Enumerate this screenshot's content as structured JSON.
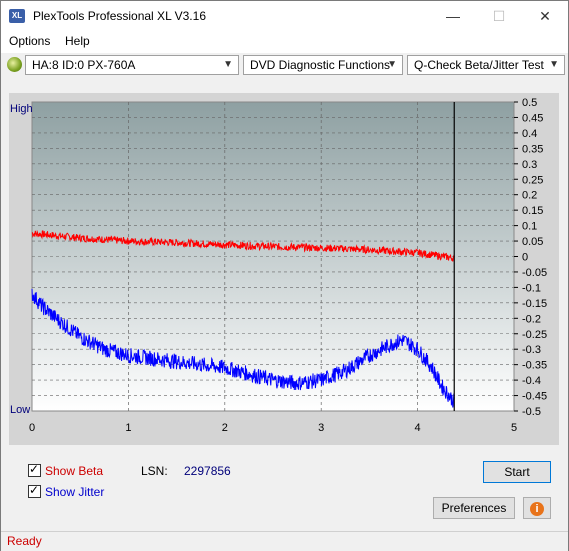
{
  "window": {
    "title": "PlexTools Professional XL V3.16",
    "icon_text": "XL"
  },
  "menu": {
    "items": [
      "Options",
      "Help"
    ]
  },
  "toolbar": {
    "drive": "HA:8 ID:0  PX-760A",
    "function": "DVD Diagnostic Functions",
    "test": "Q-Check Beta/Jitter Test"
  },
  "chart_data": {
    "type": "line",
    "left_axis_labels": {
      "top": "High",
      "bottom": "Low"
    },
    "x_ticks": [
      "0",
      "1",
      "2",
      "3",
      "4",
      "5"
    ],
    "xlim": [
      0,
      5
    ],
    "y_right_ticks": [
      "0.5",
      "0.45",
      "0.4",
      "0.35",
      "0.3",
      "0.25",
      "0.2",
      "0.15",
      "0.1",
      "0.05",
      "0",
      "-0.05",
      "-0.1",
      "-0.15",
      "-0.2",
      "-0.25",
      "-0.3",
      "-0.35",
      "-0.4",
      "-0.45",
      "-0.5"
    ],
    "ylim": [
      -0.5,
      0.5
    ],
    "cursor_x": 4.38,
    "grid": true,
    "series": [
      {
        "color": "#ff0000",
        "x": [
          0,
          0.5,
          1,
          1.5,
          2,
          2.5,
          3,
          3.5,
          4,
          4.38
        ],
        "y": [
          0.075,
          0.06,
          0.05,
          0.045,
          0.038,
          0.032,
          0.028,
          0.022,
          0.012,
          -0.005
        ]
      },
      {
        "color": "#0000ff",
        "x": [
          0,
          0.1,
          0.25,
          0.5,
          0.75,
          1,
          1.25,
          1.5,
          1.75,
          2,
          2.25,
          2.5,
          2.75,
          3,
          3.25,
          3.5,
          3.75,
          3.85,
          4,
          4.15,
          4.25,
          4.38
        ],
        "y": [
          -0.12,
          -0.16,
          -0.2,
          -0.26,
          -0.3,
          -0.32,
          -0.33,
          -0.34,
          -0.35,
          -0.36,
          -0.38,
          -0.4,
          -0.41,
          -0.4,
          -0.37,
          -0.32,
          -0.28,
          -0.27,
          -0.3,
          -0.36,
          -0.42,
          -0.47
        ]
      }
    ]
  },
  "options": {
    "show_beta_label": "Show Beta",
    "show_jitter_label": "Show Jitter",
    "lsn_label": "LSN:",
    "lsn_value": "2297856"
  },
  "buttons": {
    "start": "Start",
    "preferences": "Preferences",
    "info_icon": "i"
  },
  "status": {
    "text": "Ready",
    "color": "#cc0000"
  }
}
